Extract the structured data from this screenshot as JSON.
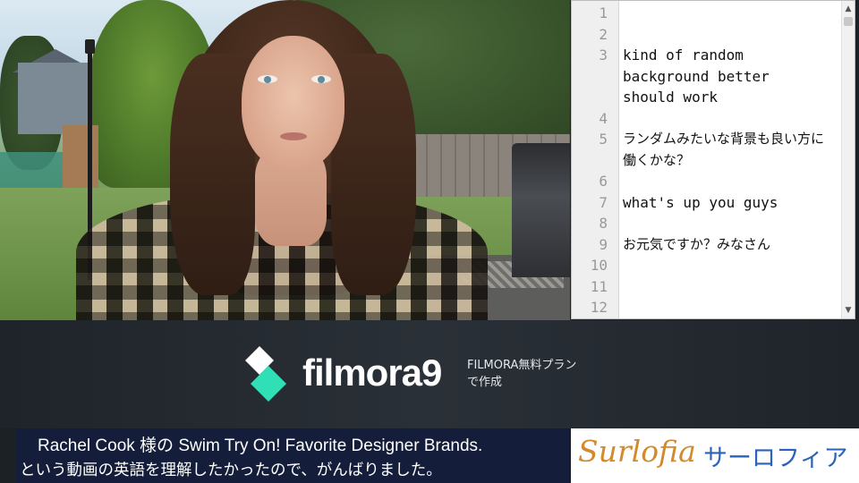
{
  "editor": {
    "lines": [
      {
        "num": "1",
        "text": ""
      },
      {
        "num": "2",
        "text": ""
      },
      {
        "num": "3",
        "text": "kind of random"
      },
      {
        "num": "",
        "text": "background better"
      },
      {
        "num": "",
        "text": "should work"
      },
      {
        "num": "4",
        "text": ""
      },
      {
        "num": "5",
        "text": "ランダムみたいな背景も良い方に"
      },
      {
        "num": "",
        "text": "働くかな？"
      },
      {
        "num": "6",
        "text": ""
      },
      {
        "num": "7",
        "text": "what's up you guys"
      },
      {
        "num": "8",
        "text": ""
      },
      {
        "num": "9",
        "text": "お元気ですか？みなさん"
      },
      {
        "num": "10",
        "text": ""
      },
      {
        "num": "11",
        "text": ""
      },
      {
        "num": "12",
        "text": ""
      }
    ],
    "scroll_up_icon": "▲",
    "scroll_down_icon": "▼"
  },
  "watermark": {
    "brand": "filmora9",
    "plan_line1": "FILMORA無料プラン",
    "plan_line2": "で作成",
    "colors": {
      "mark_white": "#ffffff",
      "mark_teal": "#2fe0b7"
    }
  },
  "caption": {
    "line1": "Rachel Cook 様の Swim Try On! Favorite Designer Brands.",
    "line2": "という動画の英語を理解したかったので、がんばりました。"
  },
  "sponsor": {
    "script": "Surlofia",
    "kana": "サーロフィア",
    "colors": {
      "script": "#d28a2c",
      "kana": "#2a63b8"
    }
  }
}
